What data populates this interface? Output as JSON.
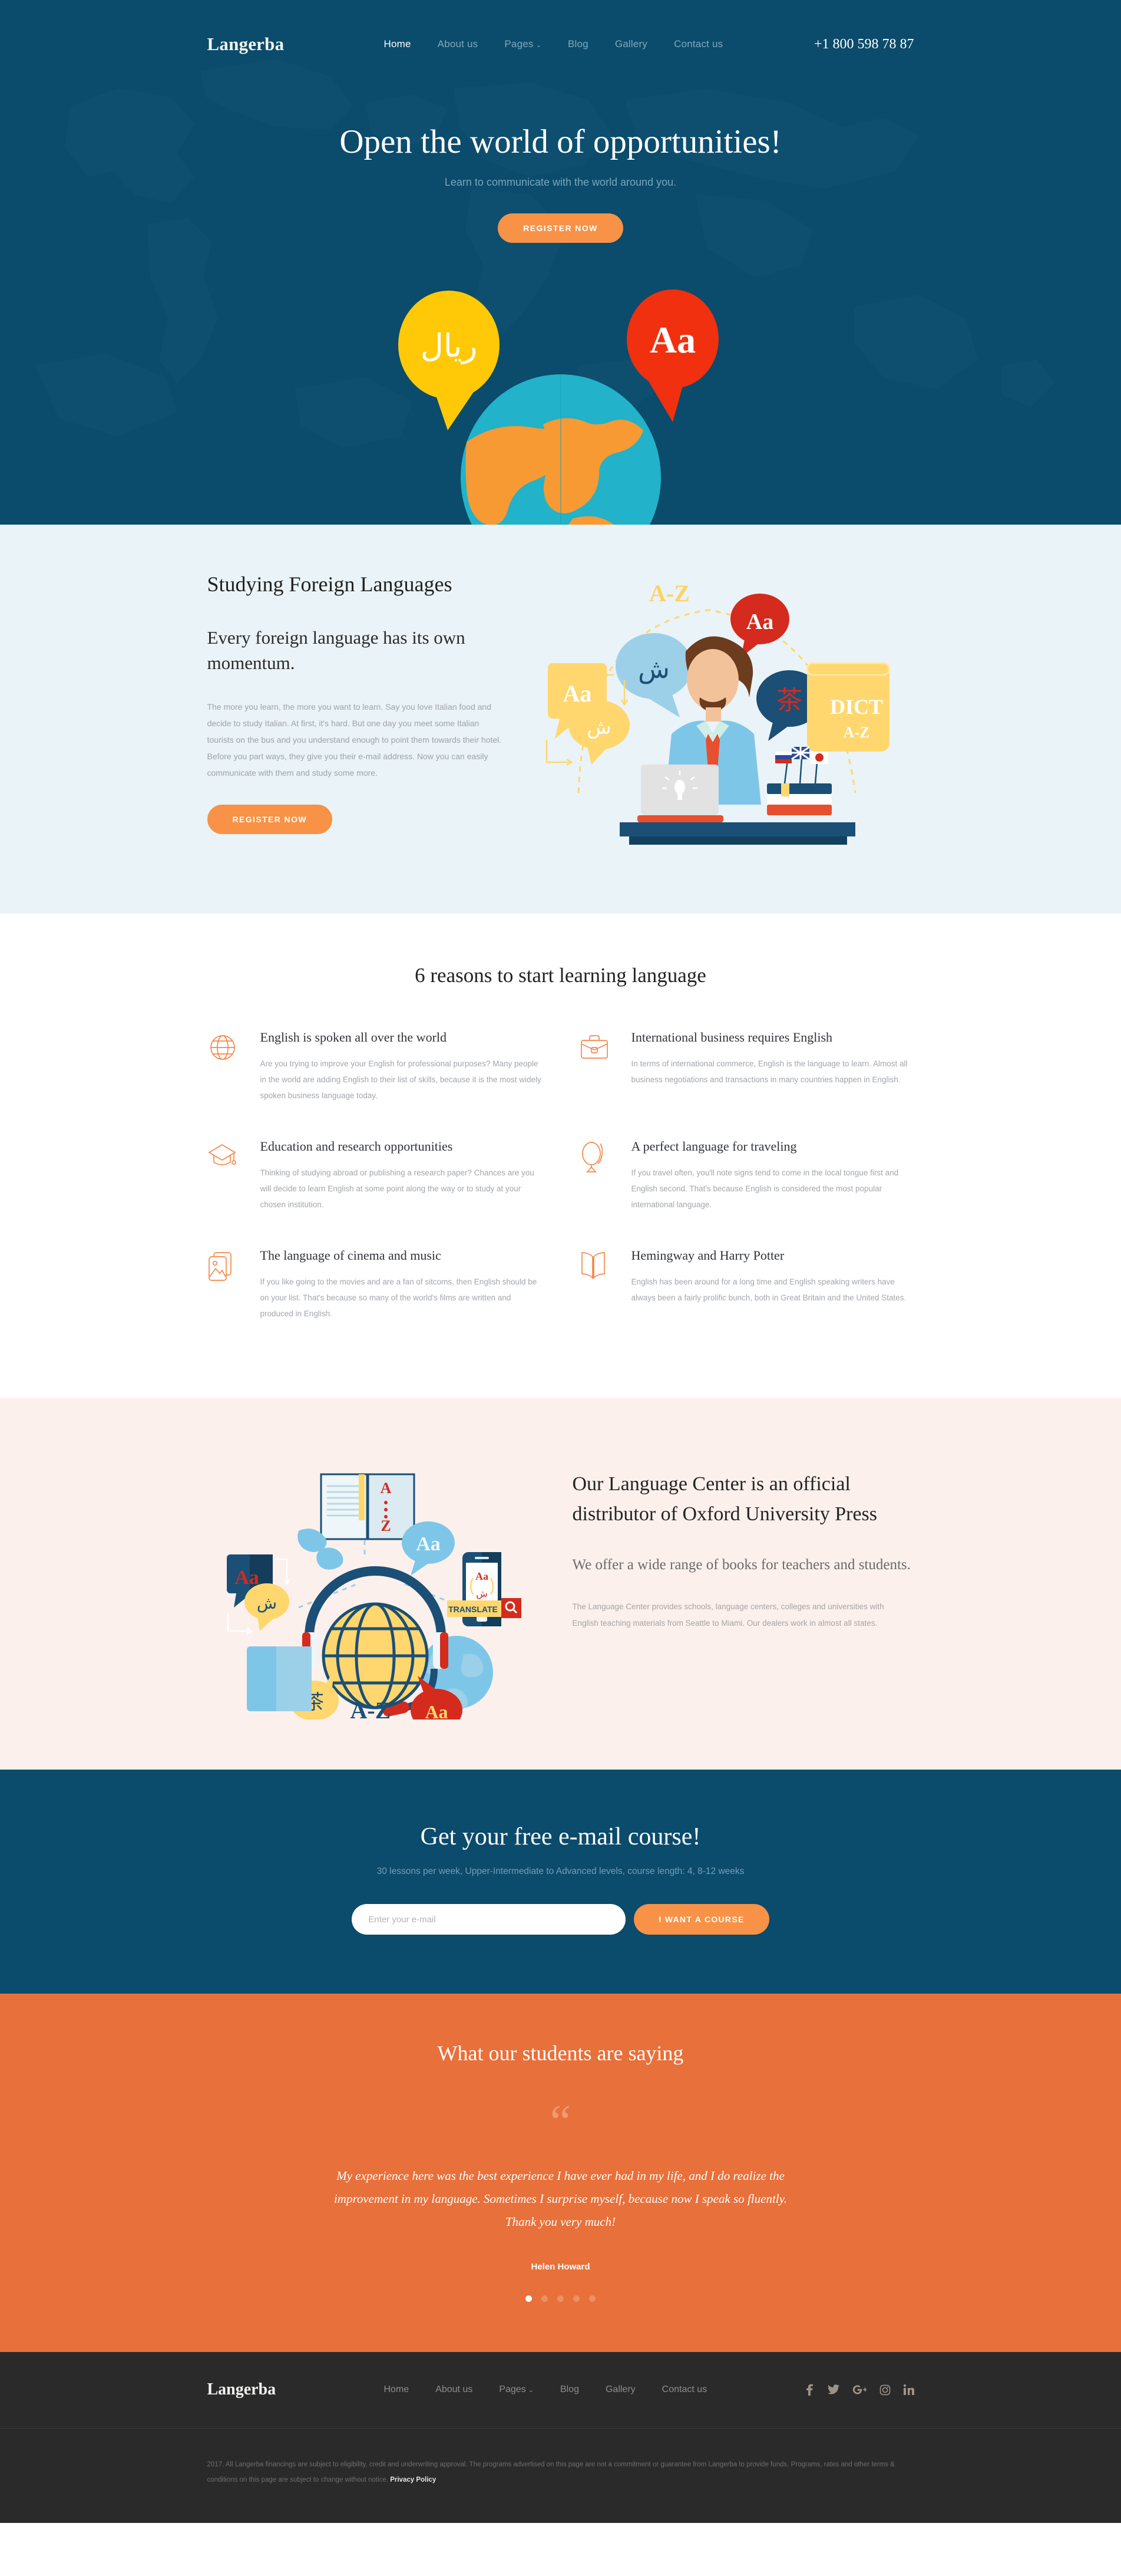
{
  "brand": {
    "name": "Langerba"
  },
  "header": {
    "nav": [
      {
        "label": "Home",
        "active": true
      },
      {
        "label": "About us",
        "active": false
      },
      {
        "label": "Pages",
        "active": false,
        "caret": "⌄"
      },
      {
        "label": "Blog",
        "active": false
      },
      {
        "label": "Gallery",
        "active": false
      },
      {
        "label": "Contact us",
        "active": false
      }
    ],
    "phone": "+1 800 598 78 87"
  },
  "hero": {
    "title": "Open the world of opportunities!",
    "subtitle": "Learn to communicate with the world around you.",
    "cta": "REGISTER NOW",
    "bubble_left": "ريال",
    "bubble_right": "Aa"
  },
  "studying": {
    "title": "Studying Foreign Languages",
    "subtitle": "Every foreign language has its own momentum.",
    "body": "The more you learn, the more you want to learn. Say you love Italian food and decide to study Italian. At first, it's hard. But one day you meet some Italian tourists on the bus and you understand enough to point them towards their hotel. Before you part ways, they give you their e-mail address. Now you can easily communicate with them and study some more.",
    "cta": "REGISTER NOW",
    "illustration_labels": {
      "az": "A-Z",
      "aa_red": "Aa",
      "aa_yellow": "Aa",
      "arabic_blue": "ش",
      "arabic_yellow": "ش",
      "chinese": "茶",
      "dict": "DICT",
      "dict_sub": "A-Z"
    }
  },
  "reasons": {
    "title": "6 reasons to start learning language",
    "items": [
      {
        "icon": "globe-icon",
        "title": "English is spoken all over the world",
        "text": "Are you trying to improve your English for professional purposes? Many people in the world are adding English to their list of skills, because it is the most widely spoken business language today."
      },
      {
        "icon": "briefcase-icon",
        "title": "International business requires English",
        "text": "In terms of international commerce, English is the language to learn. Almost all business negotiations and transactions in many countries happen in English."
      },
      {
        "icon": "graduation-cap-icon",
        "title": "Education and research opportunities",
        "text": "Thinking of studying abroad or publishing a research paper? Chances are you will decide to learn English at some point along the way or to study at your chosen institution."
      },
      {
        "icon": "desk-globe-icon",
        "title": "A perfect language for traveling",
        "text": "If you travel often, you'll note signs tend to come in the local tongue first and English second. That's because English is considered the most popular international language."
      },
      {
        "icon": "photo-icon",
        "title": "The language of cinema and music",
        "text": "If you like going to the movies and are a fan of sitcoms, then English should be on your list. That's because so many of the world's films are written and produced in English."
      },
      {
        "icon": "open-book-icon",
        "title": "Hemingway and Harry Potter",
        "text": "English has been around for a long time and English speaking writers have always been a fairly prolific bunch, both in Great Britain and the United States."
      }
    ]
  },
  "oxford": {
    "title": "Our Language Center is an official distributor of Oxford University Press",
    "subtitle": "We offer a wide range of books for teachers and students.",
    "text": "The Language Center provides schools, language centers, colleges and universities with English teaching materials from Seattle to Miami. Our dealers work in almost all states.",
    "illustration_labels": {
      "book_a": "A",
      "book_z": "Z",
      "aa_blue": "Aa",
      "aa_red_card": "Aa",
      "aa_phone": "Aa",
      "arabic_phone": "ش",
      "arabic_yellow": "ش",
      "translate": "TRANSLATE",
      "chinese": "茶",
      "aa_orange": "Aa",
      "az": "A-Z"
    }
  },
  "email_course": {
    "title": "Get your free e-mail course!",
    "lead": "30 lessons per week, Upper-Intermediate to Advanced levels, course length: 4, 8-12 weeks",
    "placeholder": "Enter your e-mail",
    "value": "",
    "button": "I WANT A COURSE"
  },
  "testimonials": {
    "title": "What our students are saying",
    "quote_glyph": "“",
    "quote": "My experience here was the best experience I have ever had in my life, and I do realize the improvement in my language. Sometimes I surprise myself, because now I speak so fluently. Thank you very much!",
    "author": "Helen Howard",
    "dot_count": 5,
    "active_dot": 0
  },
  "footer": {
    "nav": [
      {
        "label": "Home"
      },
      {
        "label": "About us"
      },
      {
        "label": "Pages",
        "caret": "⌄"
      },
      {
        "label": "Blog"
      },
      {
        "label": "Gallery"
      },
      {
        "label": "Contact us"
      }
    ],
    "social": [
      {
        "name": "facebook-icon",
        "glyph": "f"
      },
      {
        "name": "twitter-icon",
        "glyph": "🐦"
      },
      {
        "name": "google-plus-icon",
        "glyph": "G+"
      },
      {
        "name": "instagram-icon",
        "glyph": "▢"
      },
      {
        "name": "linkedin-icon",
        "glyph": "in"
      }
    ],
    "copyright": "2017. All Langerba financings are subject to eligibility, credit and underwriting approval. The programs advertised on this page are not a commitment or guarantee from Langerba to provide funds. Programs, rates and other terms & conditions on this page are subject to change without notice.",
    "privacy": "Privacy Policy"
  },
  "colors": {
    "navy": "#0b4b6b",
    "orange": "#f79246",
    "orange_dark": "#e8703a",
    "pale_blue": "#eaf3f7",
    "pale_pink": "#fbf0ec",
    "footer_dark": "#2a2a2a"
  }
}
